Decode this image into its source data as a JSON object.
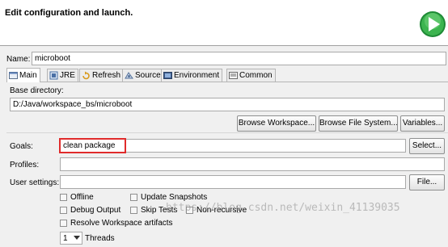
{
  "header": {
    "title": "Edit configuration and launch."
  },
  "name": {
    "label": "Name:",
    "value": "microboot"
  },
  "tabs": [
    {
      "label": "Main",
      "icon": "main-tab-icon"
    },
    {
      "label": "JRE",
      "icon": "jre-icon"
    },
    {
      "label": "Refresh",
      "icon": "refresh-icon"
    },
    {
      "label": "Source",
      "icon": "source-icon"
    },
    {
      "label": "Environment",
      "icon": "environment-icon"
    },
    {
      "label": "Common",
      "icon": "common-icon"
    }
  ],
  "base_directory": {
    "label": "Base directory:",
    "value": "D:/Java/workspace_bs/microboot",
    "buttons": {
      "workspace": "Browse Workspace...",
      "file_system": "Browse File System...",
      "variables": "Variables..."
    }
  },
  "goals": {
    "label": "Goals:",
    "value": "clean package",
    "button": "Select..."
  },
  "profiles": {
    "label": "Profiles:",
    "value": ""
  },
  "user_settings": {
    "label": "User settings:",
    "value": "",
    "button": "File..."
  },
  "options": {
    "offline": "Offline",
    "update_snapshots": "Update Snapshots",
    "debug_output": "Debug Output",
    "skip_tests": "Skip Tests",
    "non_recursive": "Non-recursive",
    "resolve_workspace": "Resolve Workspace artifacts"
  },
  "threads": {
    "value": "1",
    "label": "Threads"
  },
  "watermark": "https://blog.csdn.net/weixin_41139035",
  "colors": {
    "highlight": "#e02b2b",
    "run_button": "#2ea84a"
  }
}
